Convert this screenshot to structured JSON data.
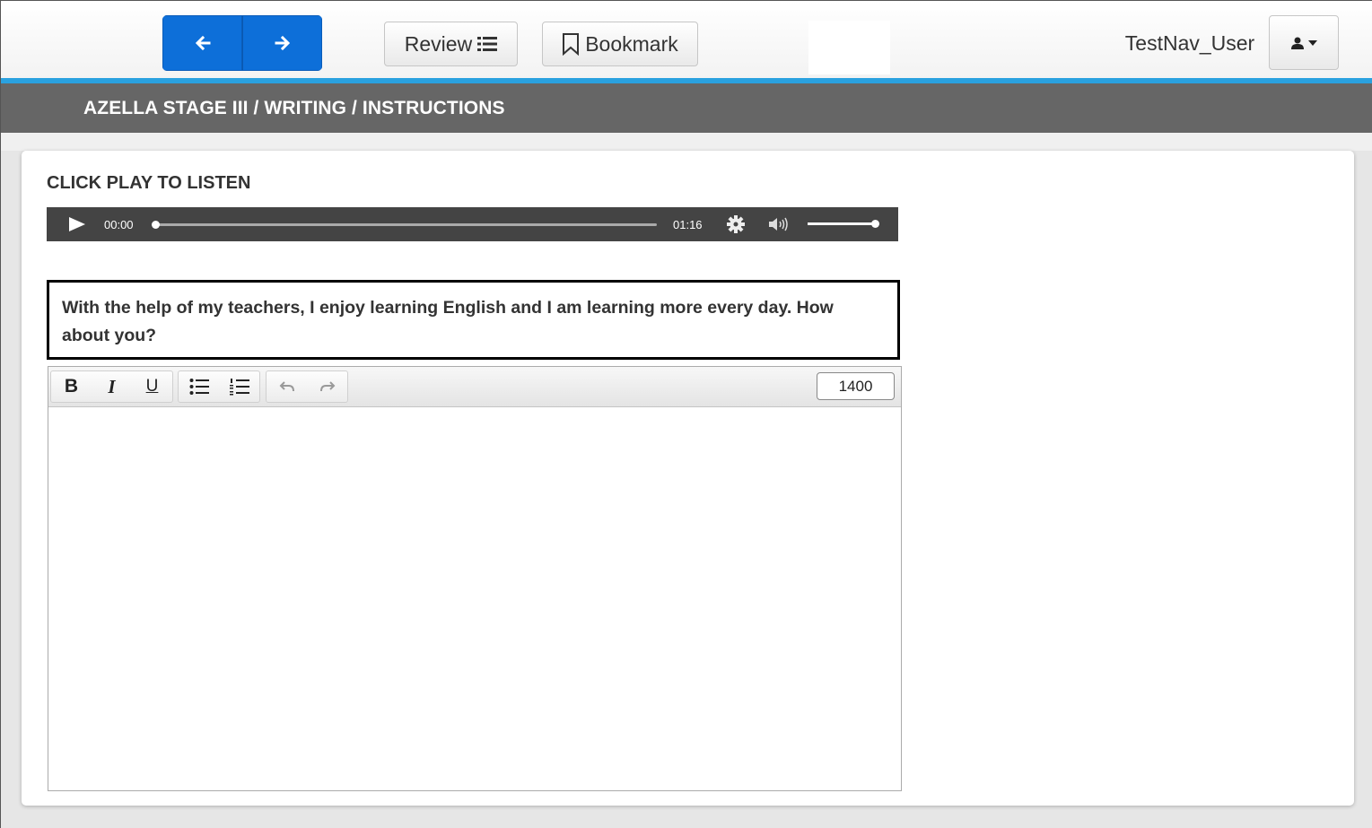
{
  "header": {
    "back_icon": "arrow-left-icon",
    "next_icon": "arrow-right-icon",
    "review_label": "Review",
    "review_icon": "list-icon",
    "bookmark_label": "Bookmark",
    "bookmark_icon": "bookmark-icon",
    "username": "TestNav_User",
    "user_menu_icon": "user-icon",
    "accent_color": "#0d6fd9",
    "strip_color": "#2aa1df"
  },
  "breadcrumb": "AZELLA STAGE III / WRITING / INSTRUCTIONS",
  "main": {
    "listen_label": "CLICK PLAY TO LISTEN",
    "player": {
      "current_time": "00:00",
      "duration": "01:16",
      "progress": 0.0,
      "volume": 1.0
    },
    "prompt_text": "With the help of my teachers, I enjoy learning English and I am learning more every day. How about you?",
    "editor": {
      "bold_label": "B",
      "italic_label": "I",
      "underline_label": "U",
      "char_limit": "1400",
      "content": ""
    }
  }
}
